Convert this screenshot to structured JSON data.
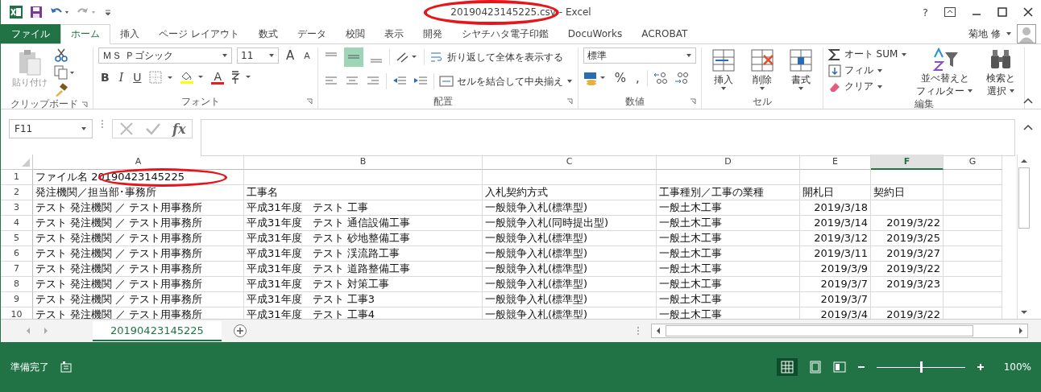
{
  "title_bar": {
    "title": "20190423145225.csv - Excel",
    "circled": true,
    "help": "?"
  },
  "ribbon_tabs": [
    {
      "label": "ファイル",
      "kind": "file",
      "selected": false
    },
    {
      "label": "ホーム",
      "kind": "tab",
      "selected": true
    },
    {
      "label": "挿入",
      "kind": "tab",
      "selected": false
    },
    {
      "label": "ページ レイアウト",
      "kind": "tab",
      "selected": false
    },
    {
      "label": "数式",
      "kind": "tab",
      "selected": false
    },
    {
      "label": "データ",
      "kind": "tab",
      "selected": false
    },
    {
      "label": "校閲",
      "kind": "tab",
      "selected": false
    },
    {
      "label": "表示",
      "kind": "tab",
      "selected": false
    },
    {
      "label": "開発",
      "kind": "tab",
      "selected": false
    },
    {
      "label": "シヤチハタ電子印鑑",
      "kind": "tab",
      "selected": false
    },
    {
      "label": "DocuWorks",
      "kind": "tab",
      "selected": false
    },
    {
      "label": "ACROBAT",
      "kind": "tab",
      "selected": false
    }
  ],
  "user": {
    "name": "菊地 修"
  },
  "ribbon": {
    "clipboard": {
      "label": "クリップボード",
      "paste": "貼り付け"
    },
    "font": {
      "label": "フォント",
      "font_name": "ＭＳ Ｐゴシック",
      "size": "11",
      "grow": "A",
      "shrink": "A",
      "bold": "B",
      "italic": "I",
      "underline": "U",
      "font_color": "A"
    },
    "alignment": {
      "label": "配置",
      "middle_selected": true,
      "wrap": "折り返して全体を表示する",
      "merge": "セルを結合して中央揃え"
    },
    "number": {
      "label": "数値",
      "format": "標準",
      "percent": "%",
      "comma": ","
    },
    "cells": {
      "label": "セル",
      "buttons": [
        "挿入",
        "削除",
        "書式"
      ]
    },
    "editing": {
      "label": "編集",
      "autosum": "オート SUM",
      "fill": "フィル",
      "clear": "クリア",
      "sort": "並べ替えと",
      "sort_2": "フィルター",
      "find": "検索と",
      "find_2": "選択"
    }
  },
  "formula_bar": {
    "name_box": "F11",
    "fx": "fx"
  },
  "sheet": {
    "columns": [
      {
        "label": "A",
        "selected": false
      },
      {
        "label": "B",
        "selected": false
      },
      {
        "label": "C",
        "selected": false
      },
      {
        "label": "D",
        "selected": false
      },
      {
        "label": "E",
        "kind": "date",
        "selected": false
      },
      {
        "label": "F",
        "kind": "date",
        "selected": true
      },
      {
        "label": "G",
        "selected": false
      }
    ],
    "rows": [
      {
        "number": "1",
        "kind": "text",
        "circled": true,
        "cells": [
          "ファイル名 20190423145225",
          "",
          "",
          "",
          "",
          "",
          ""
        ]
      },
      {
        "number": "2",
        "kind": "text",
        "cells": [
          "発注機関／担当部･事務所",
          "工事名",
          "入札契約方式",
          "工事種別／工事の業種",
          "開札日",
          "契約日",
          ""
        ]
      },
      {
        "number": "3",
        "kind": "data",
        "cells": [
          "テスト 発注機関 ／ テスト用事務所",
          "平成31年度　テスト 工事",
          "一般競争入札(標準型)",
          "一般土木工事",
          "2019/3/18",
          "",
          ""
        ]
      },
      {
        "number": "4",
        "kind": "data",
        "cells": [
          "テスト 発注機関 ／ テスト用事務所",
          "平成31年度　テスト 通信設備工事",
          "一般競争入札(同時提出型)",
          "一般土木工事",
          "2019/3/14",
          "2019/3/22",
          ""
        ]
      },
      {
        "number": "5",
        "kind": "data",
        "cells": [
          "テスト 発注機関 ／ テスト用事務所",
          "平成31年度　テスト 砂地整備工事",
          "一般競争入札(標準型)",
          "一般土木工事",
          "2019/3/12",
          "2019/3/25",
          ""
        ]
      },
      {
        "number": "6",
        "kind": "data",
        "cells": [
          "テスト 発注機関 ／ テスト用事務所",
          "平成31年度　テスト 渓流路工事",
          "一般競争入札(標準型)",
          "一般土木工事",
          "2019/3/11",
          "2019/3/27",
          ""
        ]
      },
      {
        "number": "7",
        "kind": "data",
        "cells": [
          "テスト 発注機関 ／ テスト用事務所",
          "平成31年度　テスト 道路整備工事",
          "一般競争入札(標準型)",
          "一般土木工事",
          "2019/3/9",
          "2019/3/22",
          ""
        ]
      },
      {
        "number": "8",
        "kind": "data",
        "cells": [
          "テスト 発注機関 ／ テスト用事務所",
          "平成31年度　テスト 対策工事",
          "一般競争入札(標準型)",
          "一般土木工事",
          "2019/3/7",
          "2019/3/23",
          ""
        ]
      },
      {
        "number": "9",
        "kind": "data",
        "cells": [
          "テスト 発注機関 ／ テスト用事務所",
          "平成31年度　テスト 工事3",
          "一般競争入札(標準型)",
          "一般土木工事",
          "2019/3/7",
          "",
          ""
        ]
      },
      {
        "number": "10",
        "kind": "data",
        "cells": [
          "テスト 発注機関 ／ テスト用事務所",
          "平成31年度　テスト 工事4",
          "一般競争入札(標準型)",
          "一般土木工事",
          "2019/3/4",
          "2019/3/22",
          ""
        ]
      }
    ],
    "sheet_tabs": [
      {
        "label": "20190423145225",
        "selected": true
      }
    ]
  },
  "status_bar": {
    "status": "準備完了",
    "zoom": "100%",
    "level": 0.5
  }
}
